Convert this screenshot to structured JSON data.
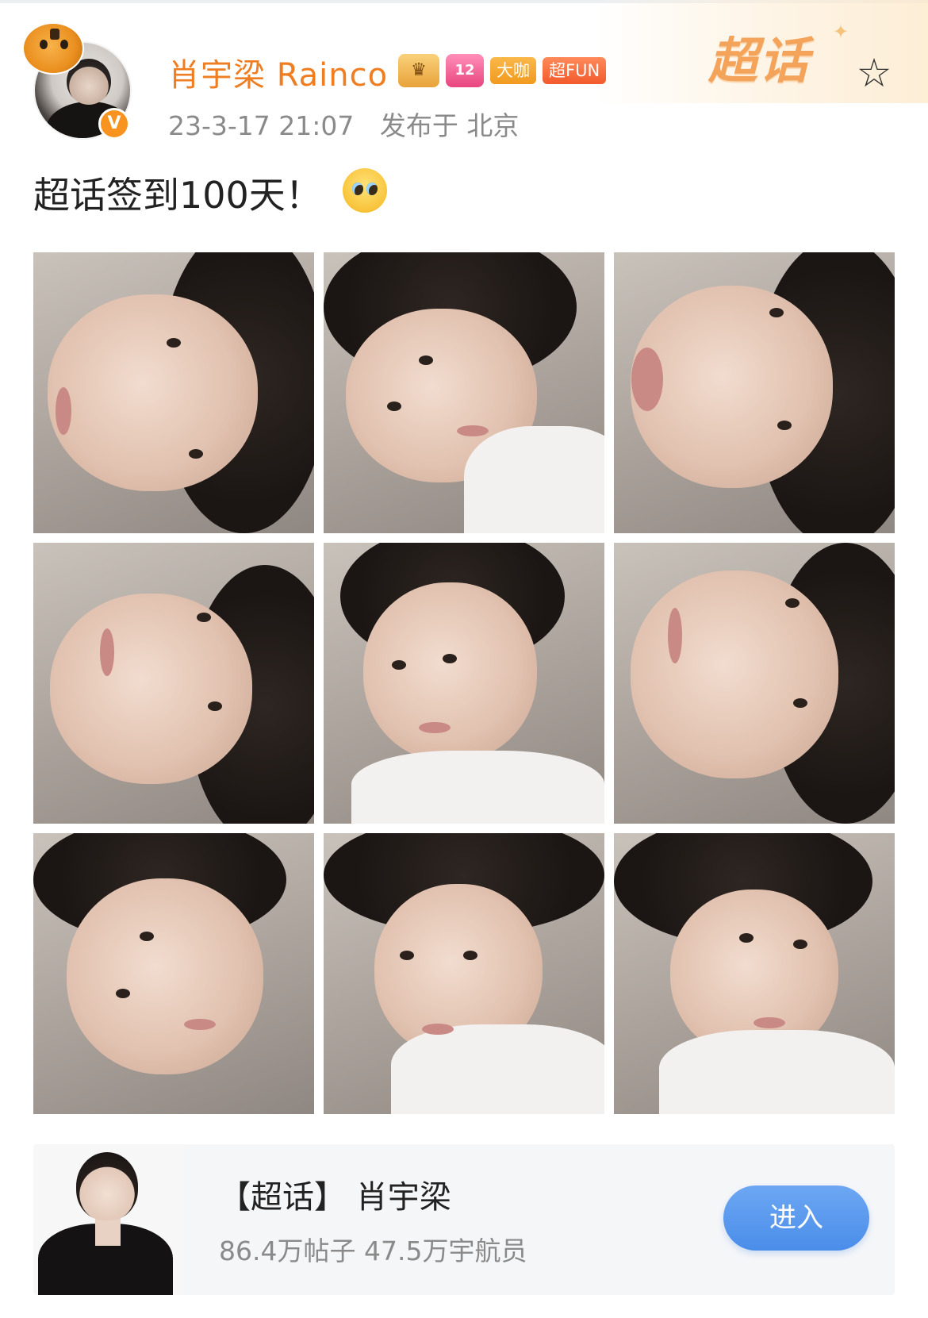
{
  "post": {
    "username": "肖宇梁 Rainco",
    "verified_badge": "V",
    "badges": {
      "crown_icon": "crown-icon",
      "gem_label": "12",
      "daka_label": "大咖",
      "fun_label": "超FUN"
    },
    "timestamp": "23-3-17 21:07",
    "location": "发布于 北京",
    "text": "超话签到100天！",
    "emoji": "pleading-face-emoji",
    "image_count": 9
  },
  "header": {
    "logo_text": "超话",
    "star_icon": "star-outline-icon"
  },
  "topic_card": {
    "title": "【超话】 肖宇梁",
    "stats": "86.4万帖子 47.5万宇航员",
    "enter_label": "进入"
  },
  "colors": {
    "username": "#ef7d21",
    "accent_orange": "#f7931e",
    "enter_button": "#4a8de9",
    "meta_text": "#8a8a8a"
  }
}
